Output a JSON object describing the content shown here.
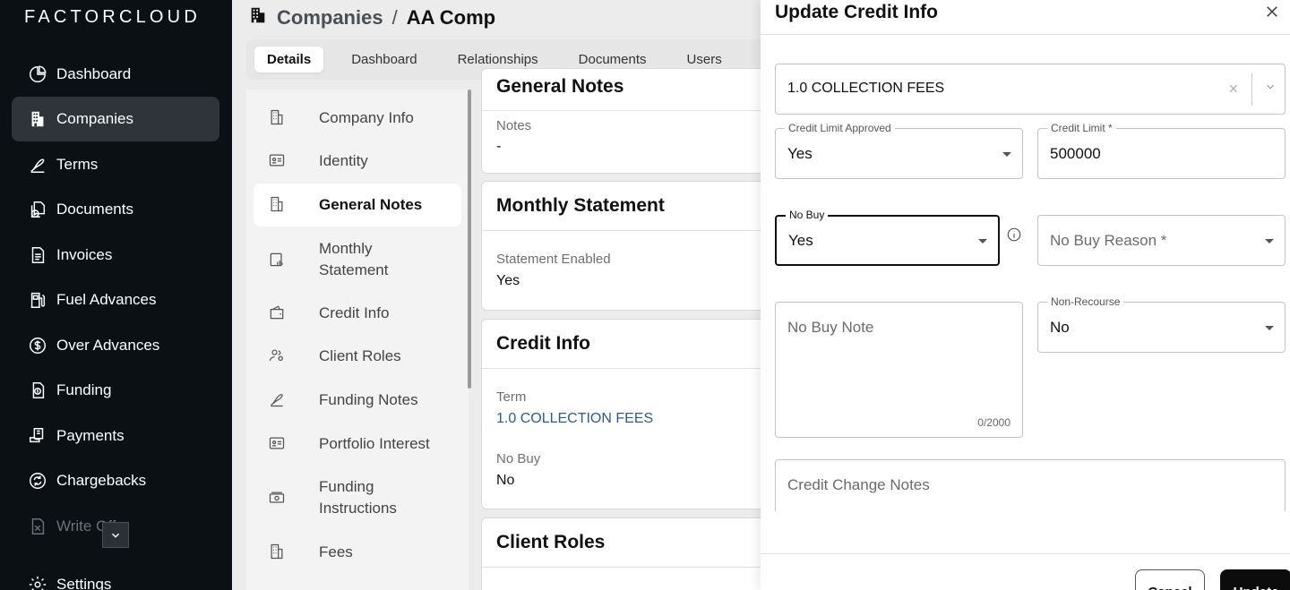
{
  "app": {
    "logo": "FACTORCLOUD"
  },
  "sidebar": {
    "items": [
      {
        "label": "Dashboard",
        "icon": "pie-chart-icon"
      },
      {
        "label": "Companies",
        "icon": "building-icon",
        "active": true
      },
      {
        "label": "Terms",
        "icon": "signature-icon"
      },
      {
        "label": "Documents",
        "icon": "documents-icon"
      },
      {
        "label": "Invoices",
        "icon": "invoice-icon"
      },
      {
        "label": "Fuel Advances",
        "icon": "fuel-icon"
      },
      {
        "label": "Over Advances",
        "icon": "dollar-circle-icon"
      },
      {
        "label": "Funding",
        "icon": "funding-icon"
      },
      {
        "label": "Payments",
        "icon": "payments-icon"
      },
      {
        "label": "Chargebacks",
        "icon": "chargeback-icon"
      },
      {
        "label": "Write Offs",
        "icon": "write-off-icon"
      },
      {
        "label": "Settings",
        "icon": "gear-icon"
      }
    ],
    "collapse_glyph": "⌄"
  },
  "header": {
    "crumb_parent": "Companies",
    "crumb_sep": "/",
    "crumb_current": "AA Comp"
  },
  "tabs": [
    "Details",
    "Dashboard",
    "Relationships",
    "Documents",
    "Users"
  ],
  "subnav": [
    {
      "label": "Company Info",
      "icon": "building-icon"
    },
    {
      "label": "Identity",
      "icon": "id-card-icon"
    },
    {
      "label": "General Notes",
      "icon": "building-icon",
      "active": true
    },
    {
      "label": "Monthly\nStatement",
      "icon": "statement-icon"
    },
    {
      "label": "Credit Info",
      "icon": "wallet-icon"
    },
    {
      "label": "Client Roles",
      "icon": "user-roles-icon"
    },
    {
      "label": "Funding Notes",
      "icon": "signature-icon"
    },
    {
      "label": "Portfolio Interest",
      "icon": "id-card-icon"
    },
    {
      "label": "Funding\nInstructions",
      "icon": "cash-icon"
    },
    {
      "label": "Fees",
      "icon": "building-icon"
    }
  ],
  "cards": {
    "general_notes": {
      "title": "General Notes",
      "notes_label": "Notes",
      "notes_value": "-"
    },
    "monthly_statement": {
      "title": "Monthly Statement",
      "enabled_label": "Statement Enabled",
      "enabled_value": "Yes"
    },
    "credit_info": {
      "title": "Credit Info",
      "term_label": "Term",
      "term_value": "1.0 COLLECTION FEES",
      "nobuy_label": "No Buy",
      "nobuy_value": "No"
    },
    "client_roles": {
      "title": "Client Roles"
    }
  },
  "panel": {
    "title": "Update Credit Info",
    "close_glyph": "✕",
    "term_select": {
      "value": "1.0 COLLECTION FEES",
      "clear_glyph": "✕"
    },
    "credit_limit_approved": {
      "label": "Credit Limit Approved",
      "value": "Yes"
    },
    "credit_limit": {
      "label": "Credit Limit *",
      "value": "500000"
    },
    "no_buy": {
      "label": "No Buy",
      "value": "Yes"
    },
    "no_buy_reason": {
      "placeholder": "No Buy Reason *"
    },
    "no_buy_note": {
      "placeholder": "No Buy Note",
      "counter": "0/2000"
    },
    "non_recourse": {
      "label": "Non-Recourse",
      "value": "No"
    },
    "credit_change_notes": {
      "placeholder": "Credit Change Notes"
    },
    "cancel_label": "Cancel",
    "update_label": "Update"
  }
}
